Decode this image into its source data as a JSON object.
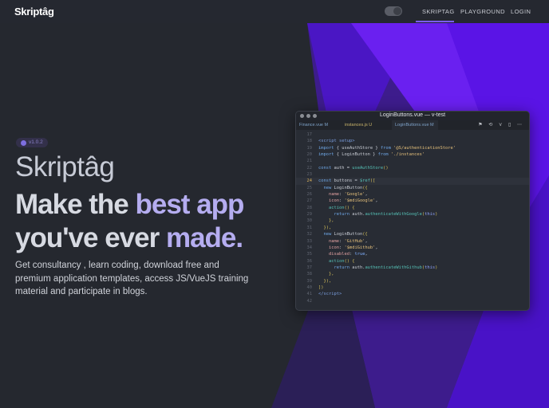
{
  "nav": {
    "logo": "Skriptâg",
    "links": [
      "SKRIPTAG",
      "PLAYGROUND",
      "LOGIN"
    ],
    "active": "SKRIPTAG"
  },
  "hero": {
    "version": "v1.0.2",
    "brand": "Skriptâg",
    "headline_a": "Make the ",
    "headline_b": "best app",
    "headline_c": "you've ever ",
    "headline_d": "made.",
    "description": "Get consultancy , learn coding, download free and premium application templates, access JS/VueJS training material and participate in blogs."
  },
  "colors": {
    "accent": "#7c5cff",
    "purple": "#5a14e6",
    "bg": "#25282f"
  },
  "editor": {
    "title": "LoginButtons.vue — v-test",
    "tabs": [
      "Finance.vue M",
      "instances.js U",
      "LoginButtons.vue M"
    ],
    "tab_icons": "⚑ ⟲ ⋎ ▯ ⋯",
    "current_line": 24,
    "lines": [
      {
        "n": "17",
        "t": []
      },
      {
        "n": "18",
        "t": [
          [
            "<script setup>",
            "tag"
          ]
        ]
      },
      {
        "n": "19",
        "t": [
          [
            "import",
            "kw"
          ],
          [
            " { useAuthStore } ",
            "plain"
          ],
          [
            "from",
            "kw"
          ],
          [
            " '@S/authenticationStore'",
            "str"
          ]
        ]
      },
      {
        "n": "20",
        "t": [
          [
            "import",
            "kw"
          ],
          [
            " { LoginButton } ",
            "plain"
          ],
          [
            "from",
            "kw"
          ],
          [
            " './instances'",
            "str"
          ]
        ]
      },
      {
        "n": "21",
        "t": []
      },
      {
        "n": "22",
        "t": [
          [
            "const",
            "kw"
          ],
          [
            " auth = ",
            "plain"
          ],
          [
            "useAuthStore",
            "fn"
          ],
          [
            "()",
            "br"
          ]
        ]
      },
      {
        "n": "23",
        "t": []
      },
      {
        "n": "24",
        "t": [
          [
            "const",
            "kw"
          ],
          [
            " buttons = ",
            "plain"
          ],
          [
            "$ref",
            "fn"
          ],
          [
            "([",
            "br"
          ]
        ]
      },
      {
        "n": "25",
        "t": [
          [
            "  new ",
            "kw"
          ],
          [
            "LoginButton",
            "plain"
          ],
          [
            "({",
            "br"
          ]
        ]
      },
      {
        "n": "26",
        "t": [
          [
            "    name",
            "prop"
          ],
          [
            ": ",
            "plain"
          ],
          [
            "'Google'",
            "str"
          ],
          [
            ",",
            "plain"
          ]
        ]
      },
      {
        "n": "27",
        "t": [
          [
            "    icon",
            "prop"
          ],
          [
            ": ",
            "plain"
          ],
          [
            "'$mdiGoogle'",
            "str"
          ],
          [
            ",",
            "plain"
          ]
        ]
      },
      {
        "n": "28",
        "t": [
          [
            "    action",
            "fn"
          ],
          [
            "() {",
            "br"
          ]
        ]
      },
      {
        "n": "29",
        "t": [
          [
            "      return ",
            "kw"
          ],
          [
            "auth.",
            "plain"
          ],
          [
            "authenticateWithGoogle",
            "fn"
          ],
          [
            "(",
            "br"
          ],
          [
            "this",
            "this"
          ],
          [
            ")",
            "br"
          ]
        ]
      },
      {
        "n": "30",
        "t": [
          [
            "    },",
            "br"
          ]
        ]
      },
      {
        "n": "31",
        "t": [
          [
            "  }),",
            "br"
          ]
        ]
      },
      {
        "n": "32",
        "t": [
          [
            "  new ",
            "kw"
          ],
          [
            "LoginButton",
            "plain"
          ],
          [
            "({",
            "br"
          ]
        ]
      },
      {
        "n": "33",
        "t": [
          [
            "    name",
            "prop"
          ],
          [
            ": ",
            "plain"
          ],
          [
            "'GitHub'",
            "str"
          ],
          [
            ",",
            "plain"
          ]
        ]
      },
      {
        "n": "34",
        "t": [
          [
            "    icon",
            "prop"
          ],
          [
            ": ",
            "plain"
          ],
          [
            "'$mdiGithub'",
            "str"
          ],
          [
            ",",
            "plain"
          ]
        ]
      },
      {
        "n": "35",
        "t": [
          [
            "    disabled",
            "prop"
          ],
          [
            ": ",
            "plain"
          ],
          [
            "true",
            "bool"
          ],
          [
            ",",
            "plain"
          ]
        ]
      },
      {
        "n": "36",
        "t": [
          [
            "    action",
            "fn"
          ],
          [
            "() {",
            "br"
          ]
        ]
      },
      {
        "n": "37",
        "t": [
          [
            "      return ",
            "kw"
          ],
          [
            "auth.",
            "plain"
          ],
          [
            "authenticateWithGithub",
            "fn"
          ],
          [
            "(",
            "br"
          ],
          [
            "this",
            "this"
          ],
          [
            ")",
            "br"
          ]
        ]
      },
      {
        "n": "38",
        "t": [
          [
            "    },",
            "br"
          ]
        ]
      },
      {
        "n": "39",
        "t": [
          [
            "  }),",
            "br"
          ]
        ]
      },
      {
        "n": "40",
        "t": [
          [
            "])",
            "br"
          ]
        ]
      },
      {
        "n": "41",
        "t": [
          [
            "</script>",
            "tag"
          ]
        ]
      },
      {
        "n": "42",
        "t": []
      }
    ]
  }
}
